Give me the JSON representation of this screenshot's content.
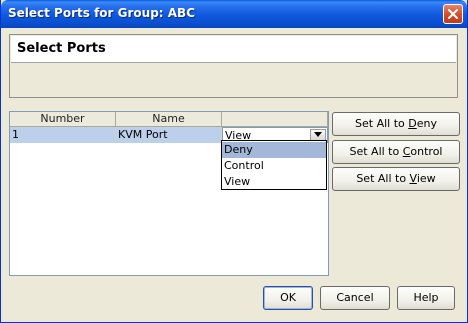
{
  "window": {
    "title": "Select Ports for Group: ABC"
  },
  "header": {
    "title": "Select Ports"
  },
  "table": {
    "columns": [
      "Number",
      "Name",
      ""
    ],
    "rows": [
      {
        "number": "1",
        "name": "KVM Port",
        "access": "View"
      }
    ]
  },
  "dropdown": {
    "options": [
      "Deny",
      "Control",
      "View"
    ],
    "highlighted": "Deny"
  },
  "side_buttons": {
    "deny": {
      "pre": "Set All to ",
      "key": "D",
      "post": "eny"
    },
    "control": {
      "pre": "Set All to ",
      "key": "C",
      "post": "ontrol"
    },
    "view": {
      "pre": "Set All to ",
      "key": "V",
      "post": "iew"
    }
  },
  "bottom_buttons": {
    "ok": "OK",
    "cancel": "Cancel",
    "help": "Help"
  },
  "colors": {
    "titlebar": "#0a50d8",
    "selection": "#bdd0eb",
    "highlight": "#a3b8d8"
  }
}
